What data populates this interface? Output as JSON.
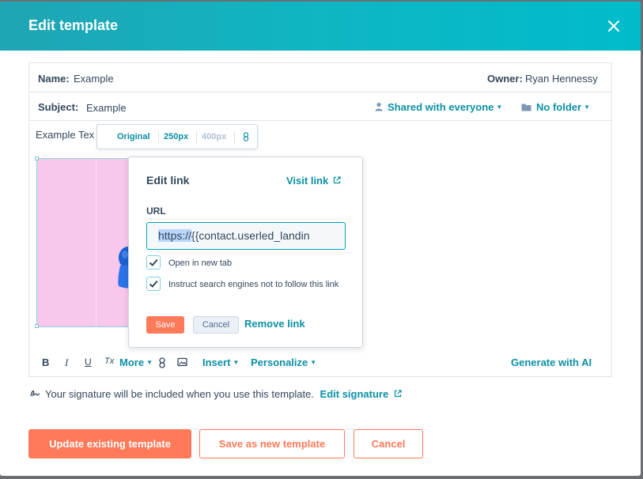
{
  "modal": {
    "title": "Edit template"
  },
  "template": {
    "name_label": "Name:",
    "name_value": "Example",
    "owner_label": "Owner:",
    "owner_value": "Ryan Hennessy",
    "subject_label": "Subject:",
    "subject_value": "Example",
    "sharing": "Shared with everyone",
    "folder": "No folder"
  },
  "editor": {
    "body_text": "Example Tex",
    "image_toolbar": {
      "original": "Original",
      "size_250": "250px",
      "size_400": "400px"
    },
    "toolbar": {
      "bold": "B",
      "italic": "I",
      "underline": "U",
      "clear_format": "Tx",
      "more": "More",
      "insert": "Insert",
      "personalize": "Personalize",
      "generate_ai": "Generate with AI"
    }
  },
  "link_popover": {
    "title": "Edit link",
    "visit_link": "Visit link",
    "url_label": "URL",
    "url_selected": "https://",
    "url_rest": "{{contact.userled_landin",
    "open_new_tab": "Open in new tab",
    "open_new_tab_checked": true,
    "nofollow": "Instruct search engines not to follow this link",
    "nofollow_checked": true,
    "save": "Save",
    "cancel": "Cancel",
    "remove_link": "Remove link"
  },
  "signature": {
    "text": "Your signature will be included when you use this template.",
    "edit_link": "Edit signature"
  },
  "footer": {
    "update": "Update existing template",
    "save_new": "Save as new template",
    "cancel": "Cancel"
  },
  "colors": {
    "header_start": "#1fa5b3",
    "header_end": "#00bcca",
    "primary_orange": "#ff7a59",
    "link_teal": "#0b8fa5",
    "text_dark": "#33475b"
  }
}
